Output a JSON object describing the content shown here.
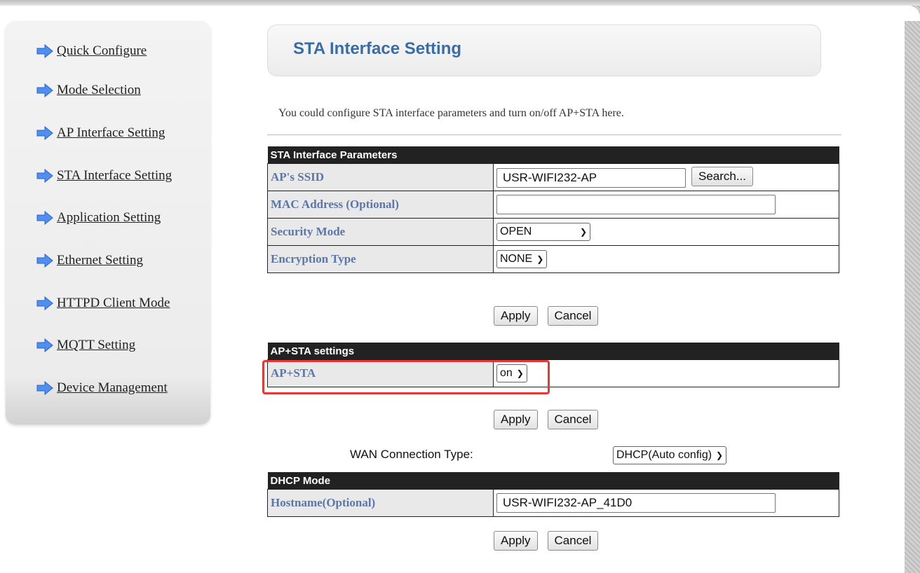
{
  "sidebar": {
    "items": [
      {
        "label": "Quick Configure"
      },
      {
        "label": "Mode Selection"
      },
      {
        "label": "AP Interface Setting"
      },
      {
        "label": "STA Interface Setting"
      },
      {
        "label": "Application Setting"
      },
      {
        "label": "Ethernet Setting"
      },
      {
        "label": "HTTPD Client Mode"
      },
      {
        "label": "MQTT Setting"
      },
      {
        "label": "Device Management"
      }
    ],
    "icon": "arrow-right-icon",
    "icon_color": "#3b82f6"
  },
  "header": {
    "title": "STA Interface Setting"
  },
  "description": "You could configure STA interface parameters and turn on/off AP+STA here.",
  "sta_params": {
    "heading": "STA Interface Parameters",
    "ssid_label": "AP's SSID",
    "ssid_value": "USR-WIFI232-AP",
    "search_label": "Search...",
    "mac_label": "MAC Address (Optional)",
    "mac_value": "",
    "security_label": "Security Mode",
    "security_value": "OPEN",
    "encryption_label": "Encryption Type",
    "encryption_value": "NONE",
    "apply_label": "Apply",
    "cancel_label": "Cancel"
  },
  "apsta": {
    "heading": "AP+STA settings",
    "label": "AP+STA",
    "value": "on",
    "apply_label": "Apply",
    "cancel_label": "Cancel"
  },
  "wan": {
    "label": "WAN Connection Type:",
    "value": "DHCP(Auto config)"
  },
  "dhcp": {
    "heading": "DHCP Mode",
    "hostname_label": "Hostname(Optional)",
    "hostname_value": "USR-WIFI232-AP_41D0",
    "apply_label": "Apply",
    "cancel_label": "Cancel"
  },
  "colors": {
    "title": "#3a6da6",
    "label": "#5b76a8",
    "table_header": "#222222",
    "highlight": "#e53935"
  }
}
